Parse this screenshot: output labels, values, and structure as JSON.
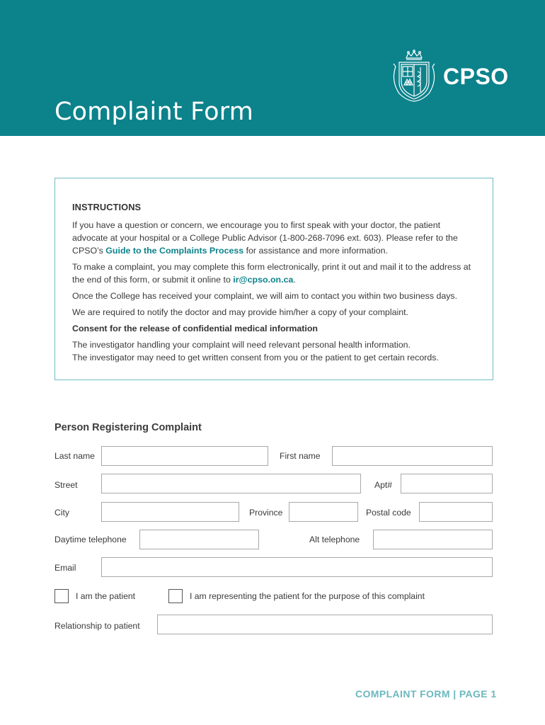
{
  "header": {
    "title": "Complaint Form",
    "logo_text": "CPSO",
    "logo_icon": "crest-icon",
    "brand_color": "#0c828b"
  },
  "instructions": {
    "heading": "INSTRUCTIONS",
    "p1_a": "If you have a question or concern, we encourage you to first speak with your doctor, the patient advocate at your hospital or a College Public Advisor (1-800-268-7096 ext. 603). Please refer to the CPSO’s ",
    "p1_link": "Guide to the Complaints Process",
    "p1_b": " for assistance and more information.",
    "p2_a": "To make a complaint, you may complete this form electronically, print it out and mail it to the address at the end of this form, or submit it online to ",
    "p2_link": "ir@cpso.on.ca",
    "p2_b": ".",
    "p3": "Once the College has received your complaint, we will aim to contact you within two business days.",
    "p4": "We are required to notify the doctor and may provide him/her a copy of your complaint.",
    "consent_heading": "Consent for the release of confidential medical information",
    "p5": "The investigator handling your complaint will need relevant personal health information.",
    "p6": "The investigator may need to get written consent from you or the patient to get certain records."
  },
  "form": {
    "section_title": "Person Registering Complaint",
    "fields": {
      "last_name": {
        "label": "Last name",
        "value": ""
      },
      "first_name": {
        "label": "First name",
        "value": ""
      },
      "street": {
        "label": "Street",
        "value": ""
      },
      "apt": {
        "label": "Apt#",
        "value": ""
      },
      "city": {
        "label": "City",
        "value": ""
      },
      "province": {
        "label": "Province",
        "value": ""
      },
      "postal_code": {
        "label": "Postal code",
        "value": ""
      },
      "daytime_telephone": {
        "label": "Daytime telephone",
        "value": ""
      },
      "alt_telephone": {
        "label": "Alt telephone",
        "value": ""
      },
      "email": {
        "label": "Email",
        "value": ""
      },
      "relationship": {
        "label": "Relationship to patient",
        "value": ""
      }
    },
    "checkboxes": {
      "is_patient": {
        "label": "I am the patient",
        "checked": false
      },
      "representing": {
        "label": "I am representing the patient for the purpose of this complaint",
        "checked": false
      }
    }
  },
  "footer": {
    "text": "COMPLAINT FORM | PAGE 1"
  }
}
